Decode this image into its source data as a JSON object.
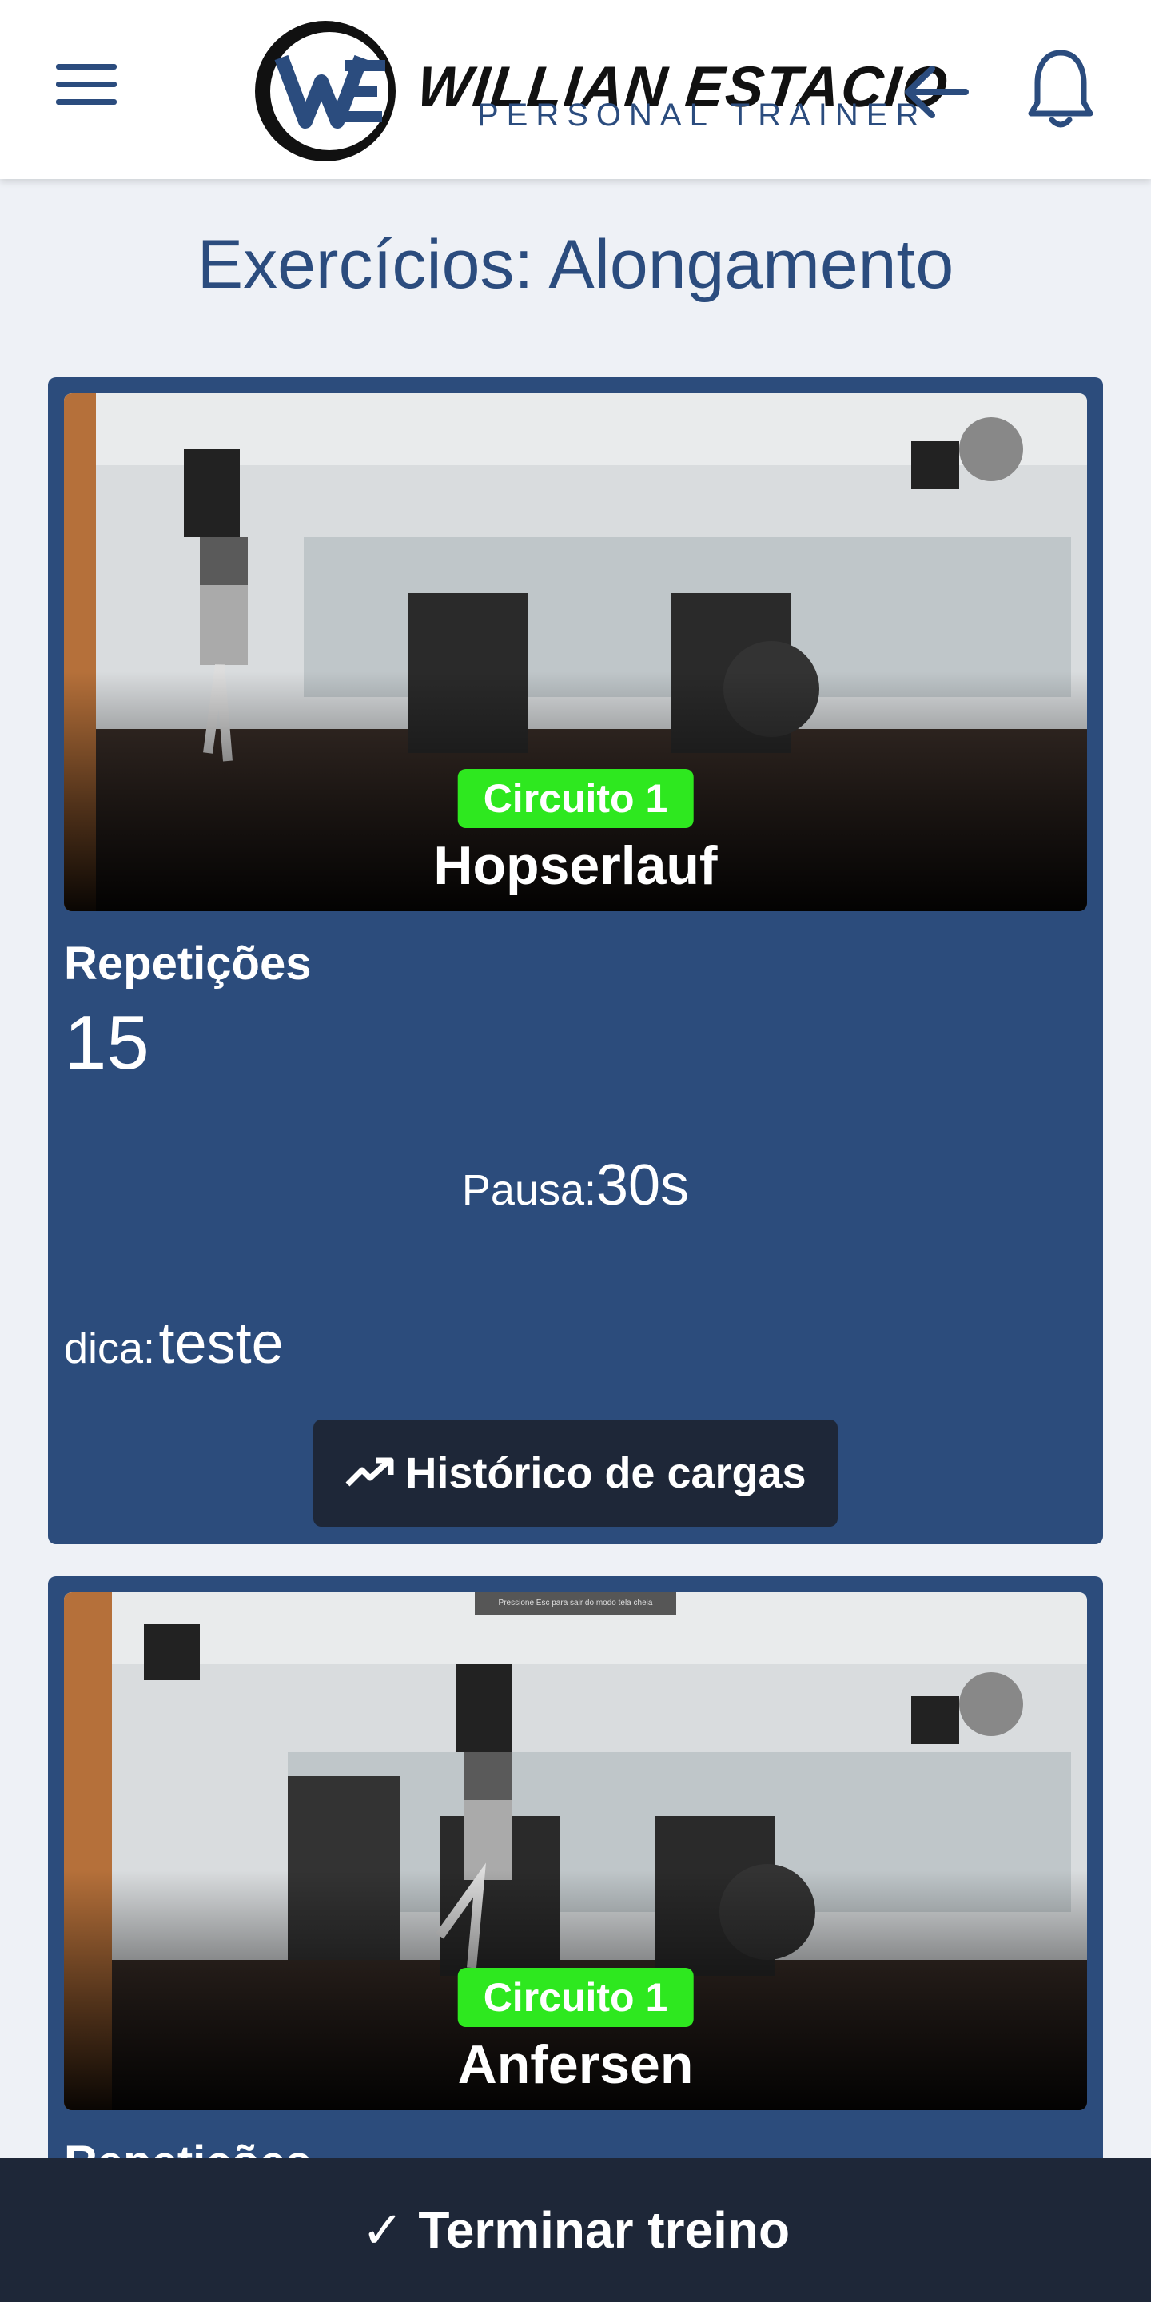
{
  "header": {
    "brand_name": "WILLIAN ESTACIO",
    "brand_subtitle": "PERSONAL TRAINER",
    "brand_monogram": "WE",
    "menu_icon": "hamburger-menu-icon",
    "back_icon": "arrow-left-icon",
    "notification_icon": "bell-icon",
    "accent_color": "#2b4c7e"
  },
  "page": {
    "title": "Exercícios: Alongamento"
  },
  "exercises": [
    {
      "circuit": "Circuito 1",
      "name": "Hopserlauf",
      "reps_label": "Repetições",
      "reps_value": "15",
      "pause_label": "Pausa:",
      "pause_value": "30s",
      "tip_label": "dica:",
      "tip_value": "teste",
      "history_button": "Histórico de cargas",
      "history_icon": "trending-up-icon"
    },
    {
      "circuit": "Circuito 1",
      "name": "Anfersen",
      "reps_label": "Repetições",
      "fullscreen_hint": "Pressione Esc para sair do modo tela cheia"
    }
  ],
  "footer": {
    "finish_button": "✓ Terminar treino"
  },
  "colors": {
    "card_background": "#2c4c7c",
    "circuit_badge": "#2ee81f",
    "dark_button": "#1e2738",
    "page_background": "#eef1f6"
  }
}
